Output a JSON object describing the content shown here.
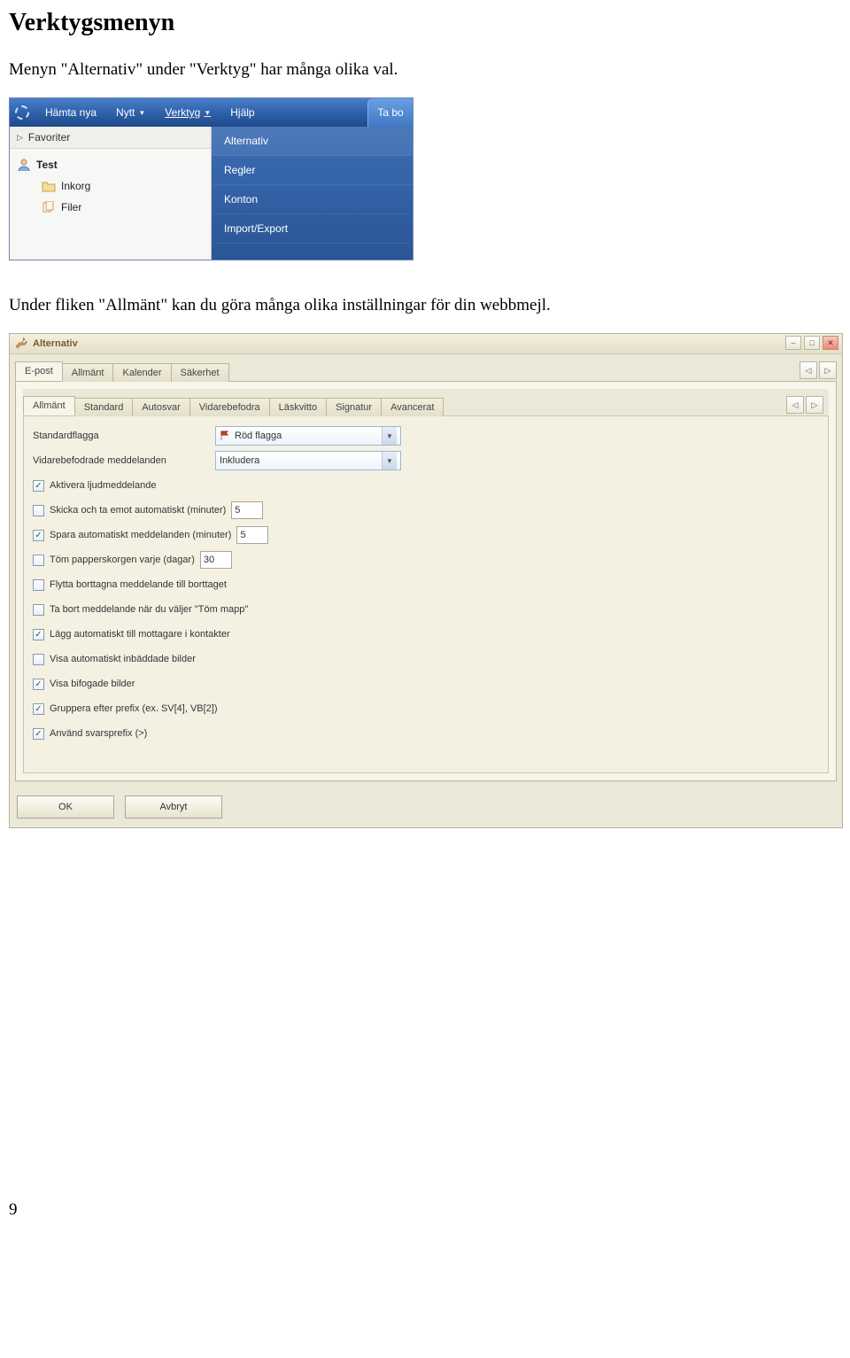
{
  "doc": {
    "title": "Verktygsmenyn",
    "intro": "Menyn \"Alternativ\" under \"Verktyg\" har många olika val.",
    "intro2": "Under fliken \"Allmänt\" kan du göra många olika inställningar för din webbmejl.",
    "pagenum": "9"
  },
  "shot1": {
    "toolbar": {
      "items": [
        "Hämta nya",
        "Nytt",
        "Verktyg",
        "Hjälp"
      ],
      "rightTab": "Ta bo"
    },
    "sidebar": {
      "fav": "Favoriter",
      "root": "Test",
      "children": [
        "Inkorg",
        "Filer"
      ]
    },
    "menu": [
      "Alternativ",
      "Regler",
      "Konton",
      "Import/Export"
    ]
  },
  "shot2": {
    "title": "Alternativ",
    "topTabs": [
      "E-post",
      "Allmänt",
      "Kalender",
      "Säkerhet"
    ],
    "topActive": 0,
    "subTabs": [
      "Allmänt",
      "Standard",
      "Autosvar",
      "Vidarebefodra",
      "Läskvitto",
      "Signatur",
      "Avancerat"
    ],
    "subActive": 0,
    "fields": {
      "stdflag_label": "Standardflagga",
      "stdflag_value": "Röd flagga",
      "fwd_label": "Vidarebefodrade meddelanden",
      "fwd_value": "Inkludera"
    },
    "options": [
      {
        "checked": true,
        "label": "Aktivera ljudmeddelande"
      },
      {
        "checked": false,
        "label": "Skicka och ta emot automatiskt (minuter)",
        "value": "5"
      },
      {
        "checked": true,
        "label": "Spara automatiskt meddelanden (minuter)",
        "value": "5"
      },
      {
        "checked": false,
        "label": "Töm papperskorgen varje (dagar)",
        "value": "30"
      },
      {
        "checked": false,
        "label": "Flytta borttagna meddelande till borttaget"
      },
      {
        "checked": false,
        "label": "Ta bort meddelande när du väljer \"Töm mapp\""
      },
      {
        "checked": true,
        "label": "Lägg automatiskt till mottagare i kontakter"
      },
      {
        "checked": false,
        "label": "Visa automatiskt inbäddade bilder"
      },
      {
        "checked": true,
        "label": "Visa bifogade bilder"
      },
      {
        "checked": true,
        "label": "Gruppera efter prefix (ex. SV[4], VB[2])"
      },
      {
        "checked": true,
        "label": "Använd svarsprefix (>)"
      }
    ],
    "buttons": {
      "ok": "OK",
      "cancel": "Avbryt"
    }
  }
}
